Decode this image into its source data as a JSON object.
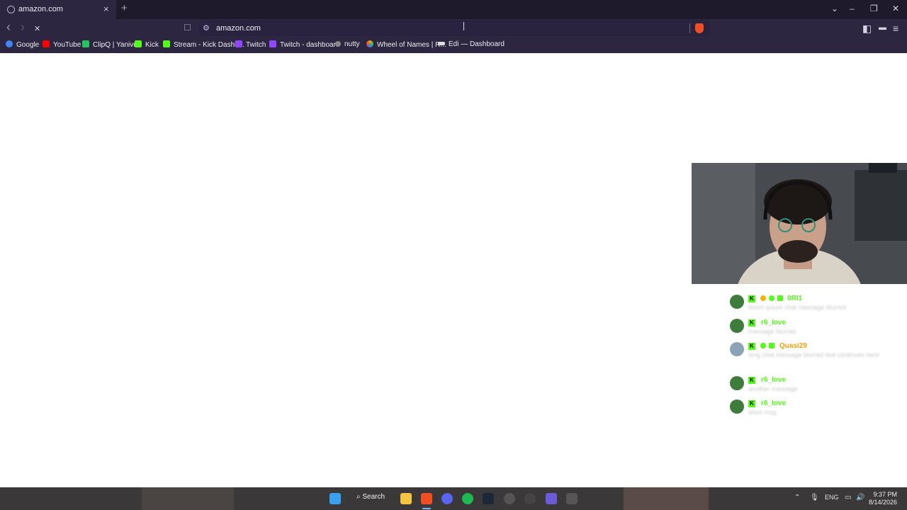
{
  "tab": {
    "title": "amazon.com",
    "close": "×",
    "new": "+"
  },
  "window": {
    "chevron": "⌄",
    "minimize": "–",
    "restore": "❐",
    "close": "✕"
  },
  "nav": {
    "back": "‹",
    "forward": "›",
    "stop": "✕",
    "bookmark": "☐",
    "sidebar": "◧",
    "menu": "≡"
  },
  "address": {
    "url": "amazon.com"
  },
  "bookmarks": [
    {
      "label": "Google",
      "icon": "google-icon",
      "color": "#4285f4"
    },
    {
      "label": "YouTube",
      "icon": "youtube-icon",
      "color": "#ff0000"
    },
    {
      "label": "ClipQ | Yanivu",
      "icon": "clipq-icon",
      "color": "#22c55e"
    },
    {
      "label": "Kick",
      "icon": "kick-icon",
      "color": "#53fc18"
    },
    {
      "label": "Stream - Kick Dashb...",
      "icon": "kick-icon",
      "color": "#53fc18"
    },
    {
      "label": "Twitch",
      "icon": "twitch-icon",
      "color": "#9146ff"
    },
    {
      "label": "Twitch - dashboard",
      "icon": "twitch-icon",
      "color": "#9146ff"
    },
    {
      "label": "nutty",
      "icon": "nutty-icon",
      "color": "#888888"
    },
    {
      "label": "Wheel of Names | R...",
      "icon": "wheel-icon",
      "color": "#f59e0b"
    },
    {
      "label": "Edi — Dashboard",
      "icon": "edi-icon",
      "color": "#dddddd"
    }
  ],
  "chat": [
    {
      "name": "0RI1",
      "color": "#53fc18",
      "message": "lorem ipsum chat message blurred"
    },
    {
      "name": "r6_love",
      "color": "#53fc18",
      "message": "message blurred"
    },
    {
      "name": "Quasi29",
      "color": "#f59e0b",
      "message": "long chat message blurred text continues here"
    },
    {
      "name": "r6_love",
      "color": "#53fc18",
      "message": "another message"
    },
    {
      "name": "r6_love",
      "color": "#53fc18",
      "message": "short msg"
    }
  ],
  "taskbar": {
    "search_label": "Search",
    "lang": "ENG",
    "time": "9:37 PM",
    "date": "8/14/2026"
  }
}
